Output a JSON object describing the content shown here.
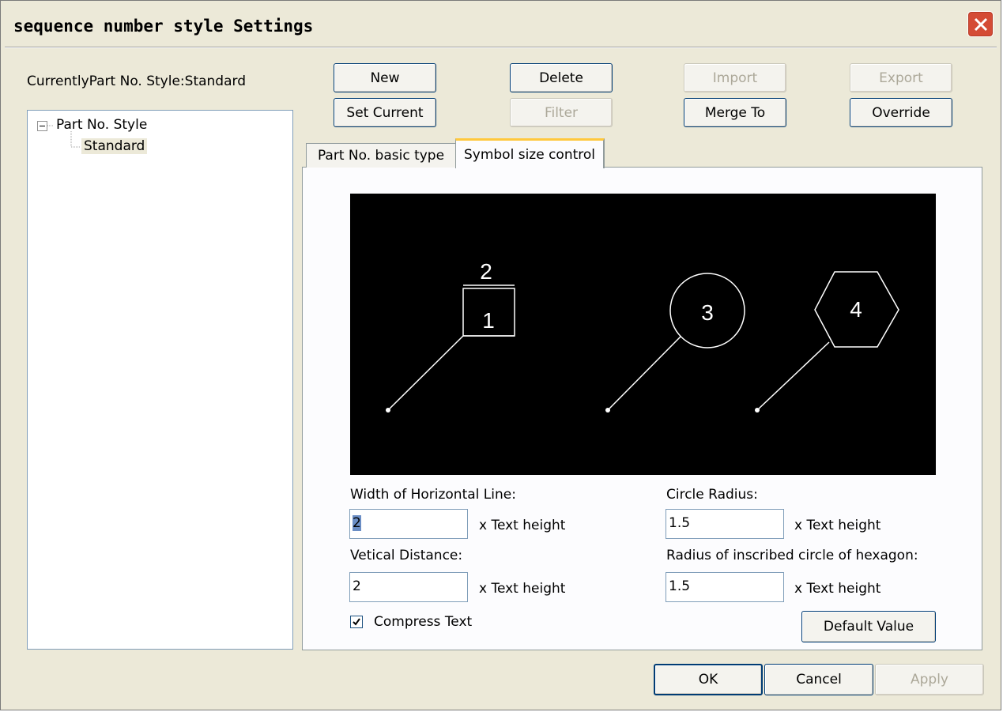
{
  "window": {
    "title": "sequence number style Settings"
  },
  "current_style": {
    "label": "CurrentlyPart No. Style:Standard"
  },
  "tree": {
    "root": "Part No. Style",
    "child": "Standard"
  },
  "buttons": {
    "new": "New",
    "delete": "Delete",
    "import": "Import",
    "export": "Export",
    "set_current": "Set Current",
    "filter": "Filter",
    "merge_to": "Merge To",
    "override": "Override",
    "default_value": "Default Value",
    "ok": "OK",
    "cancel": "Cancel",
    "apply": "Apply"
  },
  "tabs": [
    "Part No. basic type",
    "Symbol size control"
  ],
  "preview": {
    "label_top": "2",
    "label_box": "1",
    "label_circle": "3",
    "label_hexagon": "4"
  },
  "fields": {
    "width_horizontal_line": {
      "label": "Width of Horizontal Line:",
      "value": "2",
      "unit": "x Text height"
    },
    "vertical_distance": {
      "label": "Vetical Distance:",
      "value": "2",
      "unit": "x Text height"
    },
    "circle_radius": {
      "label": "Circle Radius:",
      "value": "1.5",
      "unit": "x Text height"
    },
    "hexagon_radius": {
      "label": "Radius of inscribed circle of hexagon:",
      "value": "1.5",
      "unit": "x Text height"
    }
  },
  "compress_text": {
    "label": "Compress Text",
    "checked": true
  }
}
